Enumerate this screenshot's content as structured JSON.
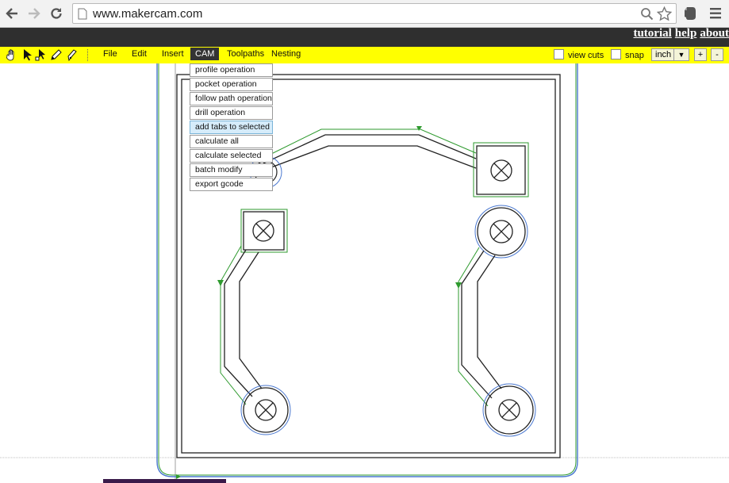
{
  "browser": {
    "url": "www.makercam.com"
  },
  "app": {
    "top_links": [
      "tutorial",
      "help",
      "about"
    ],
    "menus": [
      "File",
      "Edit",
      "Insert",
      "CAM",
      "Toolpaths",
      "Nesting"
    ],
    "active_menu": "CAM",
    "view_cuts_label": "view cuts",
    "snap_label": "snap",
    "unit_value": "inch",
    "zoom_in_label": "+",
    "zoom_out_label": "-"
  },
  "cam_menu": {
    "items": [
      "profile operation",
      "pocket operation",
      "follow path operation",
      "drill operation",
      "add tabs to selected",
      "calculate all",
      "calculate selected",
      "batch modify",
      "export gcode"
    ],
    "highlighted_index": 4
  },
  "colors": {
    "toolbar": "#ffff00",
    "appbar": "#2f2f2f",
    "toolpath_green": "#2e9a2e",
    "outline_blue": "#4a78d0"
  }
}
